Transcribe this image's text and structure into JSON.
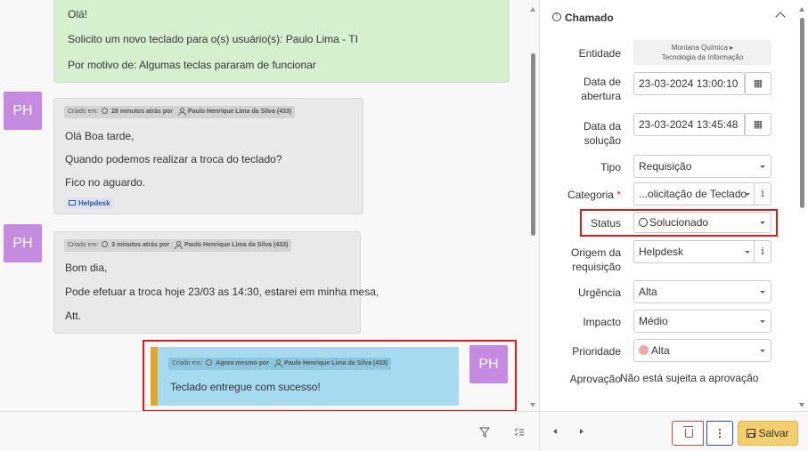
{
  "timeline": {
    "green_message": {
      "line1": "Olá!",
      "line2": "Solicito um novo teclado para o(s) usuário(s): Paulo Lima - TI",
      "line3": "Por motivo de: Algumas teclas pararam de funcionar"
    },
    "followups": [
      {
        "avatar": "PH",
        "created_prefix": "Criado em:",
        "created_time": "28 minutos atrás por",
        "author": "Paulo Henrique Lima da Silva (433)",
        "lines": [
          "Olá Boa tarde,",
          "Quando podemos realizar a troca do teclado?",
          "Fico no aguardo."
        ],
        "source_tag": "Helpdesk"
      },
      {
        "avatar": "PH",
        "created_prefix": "Criado em:",
        "created_time": "3 minutos atrás por",
        "author": "Paulo Henrique Lima da Silva (433)",
        "lines": [
          "Bom dia,",
          "Pode efetuar a troca hoje 23/03 as 14:30, estarei em minha mesa,",
          "Att."
        ]
      },
      {
        "avatar": "PH",
        "created_prefix": "Criado em:",
        "created_time": "Agora mesmo por",
        "author": "Paulo Henrique Lima da Silva (433)",
        "lines": [
          "Teclado entregue com sucesso!"
        ]
      }
    ]
  },
  "ticket": {
    "title": "Chamado",
    "fields": {
      "entidade": {
        "label": "Entidade",
        "line1": "Montana Química ▸",
        "line2": "Tecnologia da Informação"
      },
      "data_abertura": {
        "label_1": "Data de",
        "label_2": "abertura",
        "value": "23-03-2024 13:00:10"
      },
      "data_solucao": {
        "label_1": "Data da",
        "label_2": "solução",
        "value": "23-03-2024 13:45:48"
      },
      "tipo": {
        "label": "Tipo",
        "value": "Requisição"
      },
      "categoria": {
        "label": "Categoria",
        "required_mark": "*",
        "value": "...olicitação de Teclado"
      },
      "status": {
        "label": "Status",
        "value": "Solucionado"
      },
      "origem": {
        "label_1": "Origem da",
        "label_2": "requisição",
        "value": "Helpdesk"
      },
      "urgencia": {
        "label": "Urgência",
        "value": "Alta"
      },
      "impacto": {
        "label": "Impacto",
        "value": "Médio"
      },
      "prioridade": {
        "label": "Prioridade",
        "value": "Alta"
      },
      "aprovacao": {
        "label": "Aprovação",
        "value": "Não está sujeita a aprovação"
      }
    }
  },
  "toolbar": {
    "save_label": "Salvar",
    "more_label": "⋮",
    "filter_icon": "funnel-icon",
    "list_icon": "checklist-icon"
  },
  "colors": {
    "highlight": "#e01919",
    "avatar": "#c58be0",
    "green_bubble": "#d6f0cf",
    "blue_bubble": "#a6daf0",
    "save": "#f3cf6d"
  }
}
